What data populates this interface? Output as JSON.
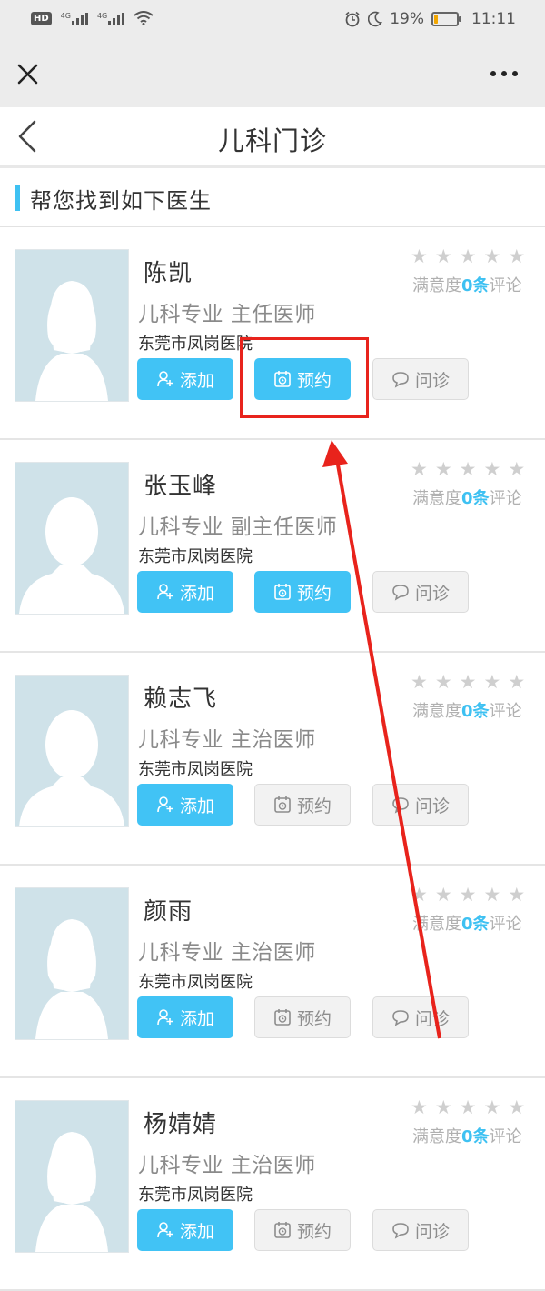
{
  "status_bar": {
    "hd": "HD",
    "net1": "4G",
    "net2": "4G",
    "battery_pct": "19%",
    "battery_level": 0.19,
    "time": "11:11"
  },
  "page": {
    "title": "儿科门诊",
    "section_label": "帮您找到如下医生"
  },
  "actions": {
    "add": "添加",
    "book": "预约",
    "consult": "问诊"
  },
  "rating_text": {
    "prefix": "满意度",
    "suffix": "评论"
  },
  "doctors": [
    {
      "name": "陈凯",
      "title": "儿科专业 主任医师",
      "hospital": "东莞市凤岗医院",
      "rating_count": "0条",
      "stars": 0,
      "gender": "female",
      "book_enabled": true
    },
    {
      "name": "张玉峰",
      "title": "儿科专业 副主任医师",
      "hospital": "东莞市凤岗医院",
      "rating_count": "0条",
      "stars": 0,
      "gender": "male",
      "book_enabled": true
    },
    {
      "name": "赖志飞",
      "title": "儿科专业 主治医师",
      "hospital": "东莞市凤岗医院",
      "rating_count": "0条",
      "stars": 0,
      "gender": "male",
      "book_enabled": false
    },
    {
      "name": "颜雨",
      "title": "儿科专业 主治医师",
      "hospital": "东莞市凤岗医院",
      "rating_count": "0条",
      "stars": 0,
      "gender": "female",
      "book_enabled": false
    },
    {
      "name": "杨婧婧",
      "title": "儿科专业 主治医师",
      "hospital": "东莞市凤岗医院",
      "rating_count": "0条",
      "stars": 0,
      "gender": "female",
      "book_enabled": false
    }
  ],
  "colors": {
    "accent": "#41c3f5",
    "annotation": "#e8231c"
  }
}
